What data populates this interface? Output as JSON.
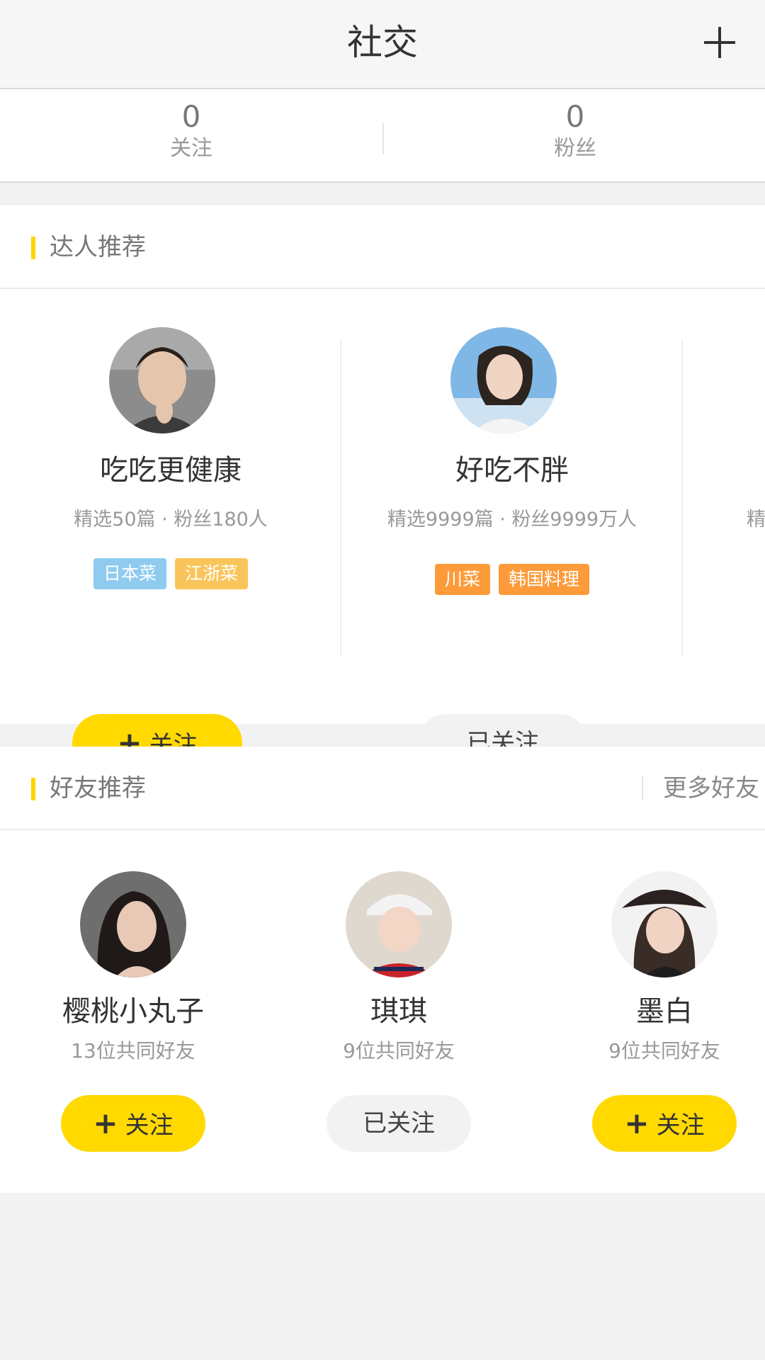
{
  "header": {
    "title": "社交",
    "add_icon": "plus-icon"
  },
  "stats": [
    {
      "value": "0",
      "label": "关注"
    },
    {
      "value": "0",
      "label": "粉丝"
    }
  ],
  "experts_section": {
    "title": "达人推荐",
    "items": [
      {
        "name": "吃吃更健康",
        "meta": "精选50篇 · 粉丝180人",
        "tags": [
          {
            "label": "日本菜",
            "color": "#8fcbef"
          },
          {
            "label": "江浙菜",
            "color": "#f9c55b"
          }
        ],
        "button": "关注",
        "followed": false
      },
      {
        "name": "好吃不胖",
        "meta": "精选9999篇 · 粉丝9999万人",
        "tags": [
          {
            "label": "川菜",
            "color": "#fd9b3a"
          },
          {
            "label": "韩国料理",
            "color": "#fd9b3a"
          }
        ],
        "button": "已关注",
        "followed": true
      },
      {
        "name": "",
        "meta": "精",
        "tags": [],
        "button": "",
        "followed": false
      }
    ]
  },
  "friends_section": {
    "title": "好友推荐",
    "more_label": "更多好友",
    "items": [
      {
        "name": "樱桃小丸子",
        "meta": "13位共同好友",
        "button": "关注",
        "followed": false
      },
      {
        "name": "琪琪",
        "meta": "9位共同好友",
        "button": "已关注",
        "followed": true
      },
      {
        "name": "墨白",
        "meta": "9位共同好友",
        "button": "关注",
        "followed": false
      }
    ]
  },
  "colors": {
    "accent": "#ffd900",
    "background": "#f2f2f2"
  }
}
